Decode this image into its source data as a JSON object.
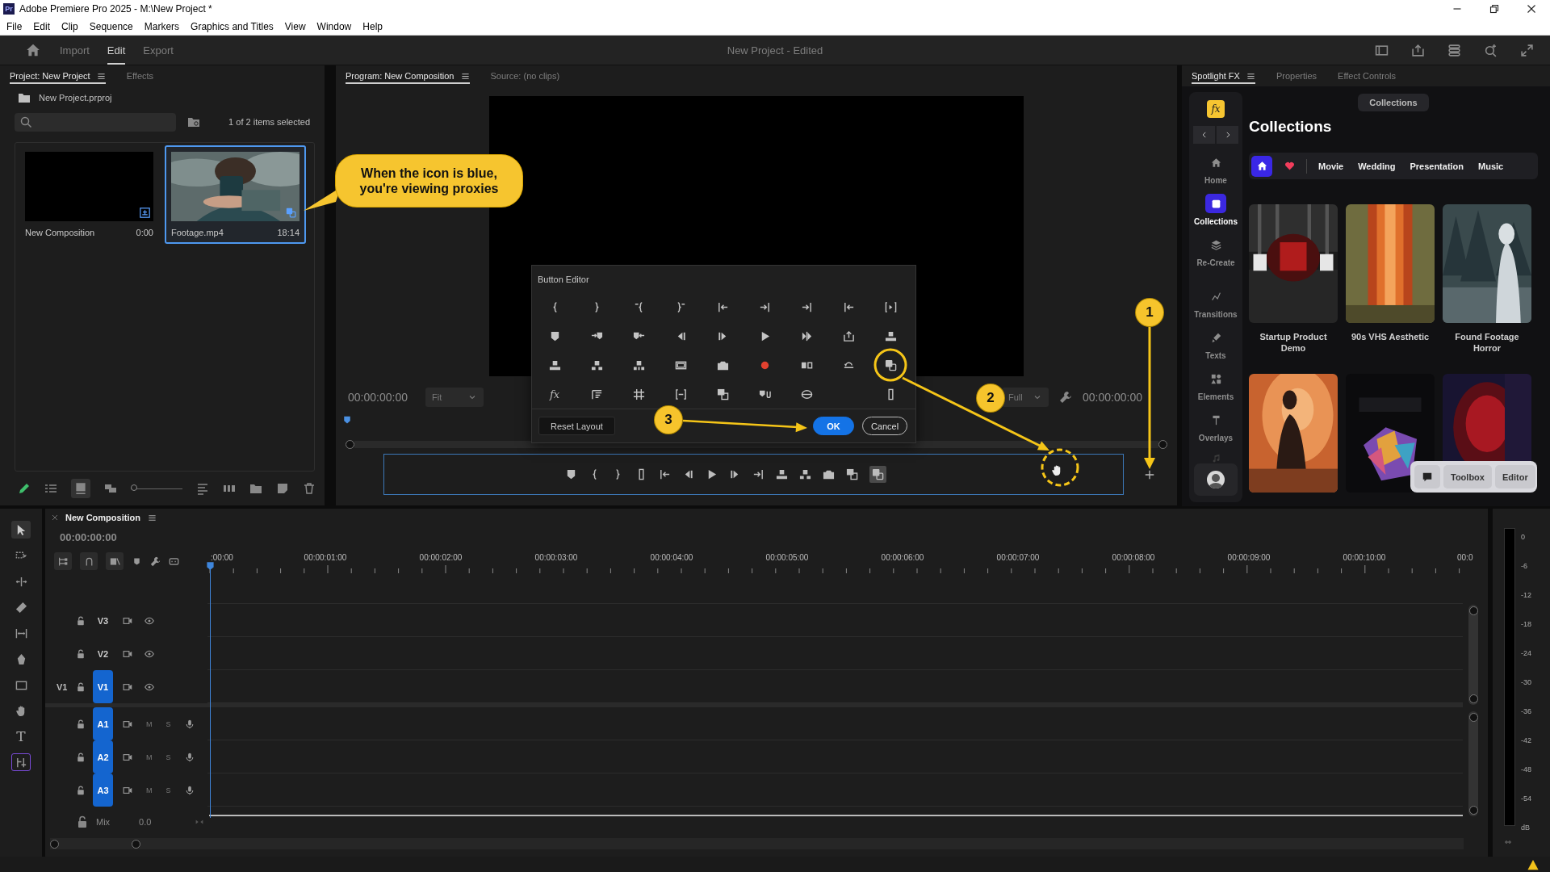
{
  "window": {
    "app_icon": "Pr",
    "title": "Adobe Premiere Pro 2025 - M:\\New Project *"
  },
  "menu": [
    "File",
    "Edit",
    "Clip",
    "Sequence",
    "Markers",
    "Graphics and Titles",
    "View",
    "Window",
    "Help"
  ],
  "header": {
    "modes": [
      {
        "label": "Import",
        "selected": false
      },
      {
        "label": "Edit",
        "selected": true
      },
      {
        "label": "Export",
        "selected": false
      }
    ],
    "title": "New Project - Edited"
  },
  "project_panel": {
    "tabs": [
      {
        "label": "Project: New Project",
        "selected": true
      },
      {
        "label": "Effects",
        "selected": false
      }
    ],
    "path": "New Project.prproj",
    "selection_count": "1 of 2 items selected",
    "zoom_slider": {
      "level": 0
    },
    "items": [
      {
        "kind": "sequence",
        "name": "New Composition",
        "duration": "0:00",
        "selected": false
      },
      {
        "kind": "clip",
        "name": "Footage.mp4",
        "duration": "18:14",
        "selected": true
      }
    ]
  },
  "callout": {
    "text": "When the icon is blue,\nyou're viewing proxies"
  },
  "program_monitor": {
    "tabs": [
      {
        "label": "Program: New Composition",
        "selected": true
      },
      {
        "label": "Source: (no clips)",
        "selected": false
      }
    ],
    "timecode": "00:00:00:00",
    "zoom": "Fit",
    "resolution": "Full",
    "duration": "00:00:00:00",
    "proxy_toggle_on": true
  },
  "button_editor": {
    "title": "Button Editor",
    "fx_label": "fx",
    "buttons": [
      {
        "label": "Reset Layout",
        "kind": "secondary"
      },
      {
        "label": "OK",
        "kind": "primary"
      },
      {
        "label": "Cancel",
        "kind": "outline"
      }
    ]
  },
  "annotations": [
    {
      "number": "1"
    },
    {
      "number": "2"
    },
    {
      "number": "3"
    }
  ],
  "spotlight_panel": {
    "tabs": [
      {
        "label": "Spotlight FX",
        "selected": true
      },
      {
        "label": "Properties",
        "selected": false
      },
      {
        "label": "Effect Controls",
        "selected": false
      }
    ],
    "logo": "fx",
    "nav": [
      {
        "label": "Home",
        "selected": false
      },
      {
        "label": "Collections",
        "selected": true
      },
      {
        "label": "Re-Create",
        "selected": false
      },
      {
        "label": "Transitions",
        "selected": false
      },
      {
        "label": "Texts",
        "selected": false
      },
      {
        "label": "Elements",
        "selected": false
      },
      {
        "label": "Overlays",
        "selected": false
      }
    ],
    "breadcrumb": "Collections",
    "heading": "Collections",
    "filters": [
      {
        "kind": "home",
        "selected": true
      },
      {
        "kind": "favorites",
        "selected": false
      },
      {
        "kind": "text",
        "label": "Movie",
        "selected": false
      },
      {
        "kind": "text",
        "label": "Wedding",
        "selected": false
      },
      {
        "kind": "text",
        "label": "Presentation",
        "selected": false
      },
      {
        "kind": "text",
        "label": "Music",
        "selected": false
      }
    ],
    "cards": [
      {
        "kind": "picture",
        "title": "Startup Product Demo"
      },
      {
        "kind": "picture",
        "title": "90s VHS Aesthetic"
      },
      {
        "kind": "picture",
        "title": "Found Footage Horror"
      },
      {
        "kind": "picture"
      },
      {
        "kind": "picture"
      },
      {
        "kind": "picture"
      }
    ],
    "floating_toolbar": [
      "Toolbox",
      "Editor"
    ]
  },
  "tools": [
    {
      "selected": true
    },
    {
      "selected": false
    },
    {
      "selected": false
    },
    {
      "selected": false
    },
    {
      "selected": false
    },
    {
      "selected": false
    },
    {
      "selected": false
    },
    {
      "selected": false
    },
    {
      "selected": false,
      "glyph": "T"
    },
    {
      "selected": false
    }
  ],
  "timeline": {
    "title": "New Composition",
    "timecode": "00:00:00:00",
    "ruler": [
      ":00:00",
      "00:00:01:00",
      "00:00:02:00",
      "00:00:03:00",
      "00:00:04:00",
      "00:00:05:00",
      "00:00:06:00",
      "00:00:07:00",
      "00:00:08:00",
      "00:00:09:00",
      "00:00:10:00",
      "00:0"
    ],
    "tracks": [
      {
        "kind": "video",
        "label": "V3",
        "targeted": false
      },
      {
        "kind": "video",
        "label": "V2",
        "targeted": false
      },
      {
        "kind": "video",
        "label": "V1",
        "source": "V1",
        "targeted": true
      },
      {
        "kind": "audio",
        "label": "A1",
        "targeted": true,
        "mute": "M",
        "solo": "S"
      },
      {
        "kind": "audio",
        "label": "A2",
        "targeted": true,
        "mute": "M",
        "solo": "S"
      },
      {
        "kind": "audio",
        "label": "A3",
        "targeted": true,
        "mute": "M",
        "solo": "S"
      }
    ],
    "mix": {
      "label": "Mix",
      "value": "0.0"
    }
  },
  "meter": {
    "scale": [
      "0",
      "-6",
      "-12",
      "-18",
      "-24",
      "-30",
      "-36",
      "-42",
      "-48",
      "-54",
      "dB"
    ]
  }
}
